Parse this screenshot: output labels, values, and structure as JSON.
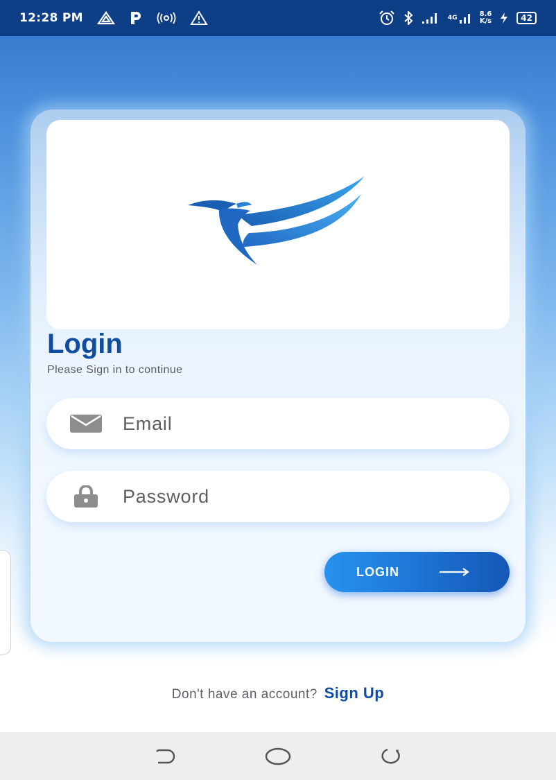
{
  "status_bar": {
    "time": "12:28 PM",
    "left_icons": [
      "navigation-icon",
      "parking-icon",
      "hotspot-icon",
      "warning-icon"
    ],
    "right_icons": [
      "alarm-icon",
      "bluetooth-icon",
      "signal-icon",
      "4g-signal-icon",
      "charging-icon"
    ],
    "network_type": "4G",
    "speed_value": "8.6",
    "speed_unit": "K/s",
    "battery": "42"
  },
  "logo": {
    "icon": "bird-logo-icon",
    "color_light": "#2e9be8",
    "color_dark": "#1a5fb4"
  },
  "login": {
    "title": "Login",
    "subtitle": "Please Sign in to continue",
    "email_placeholder": "Email",
    "password_placeholder": "Password",
    "email_icon": "mail-icon",
    "password_icon": "lock-icon",
    "button_label": "LOGIN",
    "button_icon": "arrow-right-icon"
  },
  "signup": {
    "prompt": "Don't have an account?",
    "link": "Sign Up"
  },
  "nav_bar": {
    "back_icon": "back-icon",
    "home_icon": "home-icon",
    "recents_icon": "recents-icon"
  },
  "colors": {
    "accent": "#0f4da3",
    "button_start": "#2693ee",
    "button_end": "#1557b7",
    "status_bar": "#0e3f86"
  }
}
